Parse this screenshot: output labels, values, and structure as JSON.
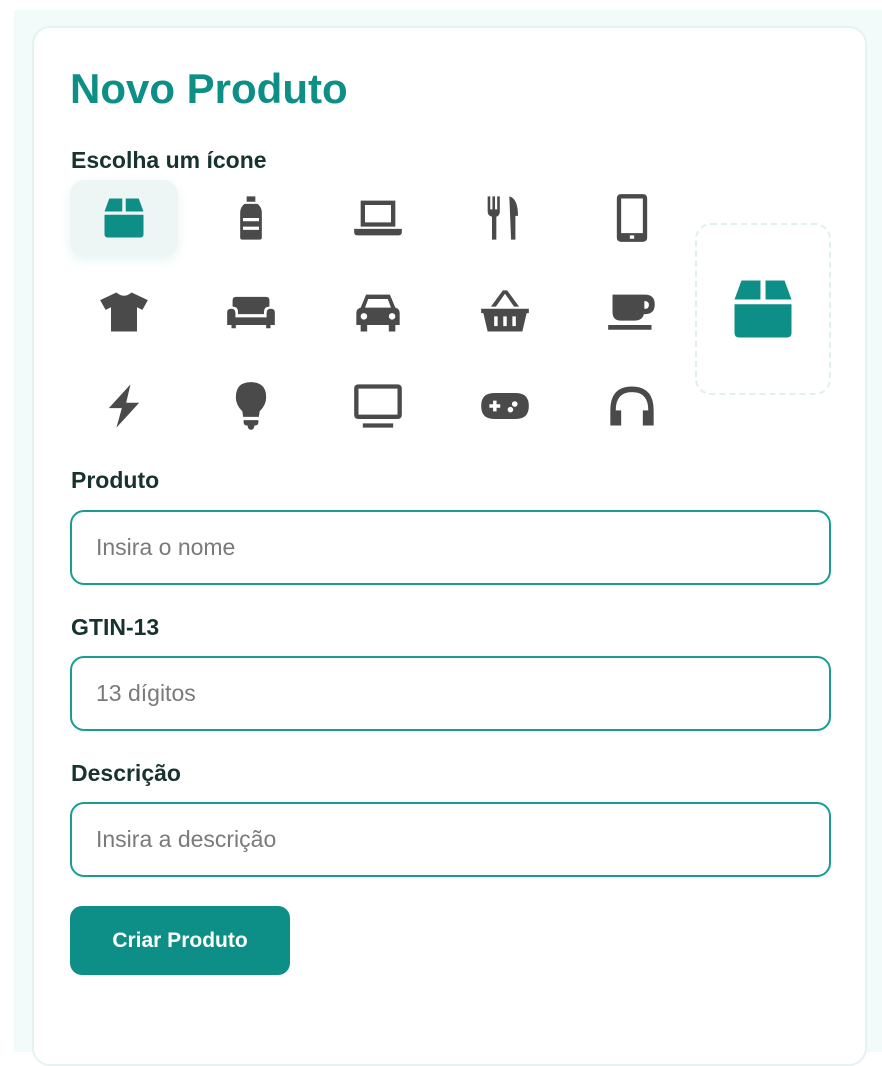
{
  "form": {
    "title": "Novo Produto",
    "icon_label": "Escolha um ícone",
    "icons": [
      {
        "name": "box-icon",
        "selected": true
      },
      {
        "name": "bottle-icon",
        "selected": false
      },
      {
        "name": "laptop-icon",
        "selected": false
      },
      {
        "name": "utensils-icon",
        "selected": false
      },
      {
        "name": "mobile-icon",
        "selected": false
      },
      {
        "name": "shirt-icon",
        "selected": false
      },
      {
        "name": "couch-icon",
        "selected": false
      },
      {
        "name": "car-icon",
        "selected": false
      },
      {
        "name": "basket-icon",
        "selected": false
      },
      {
        "name": "mug-icon",
        "selected": false
      },
      {
        "name": "bolt-icon",
        "selected": false
      },
      {
        "name": "lightbulb-icon",
        "selected": false
      },
      {
        "name": "monitor-icon",
        "selected": false
      },
      {
        "name": "gamepad-icon",
        "selected": false
      },
      {
        "name": "headphones-icon",
        "selected": false
      }
    ],
    "preview_icon": "box-icon",
    "product_label": "Produto",
    "product_placeholder": "Insira o nome",
    "product_value": "",
    "gtin_label": "GTIN-13",
    "gtin_placeholder": "13 dígitos",
    "gtin_value": "",
    "description_label": "Descrição",
    "description_placeholder": "Insira a descrição",
    "description_value": "",
    "submit_label": "Criar Produto"
  },
  "colors": {
    "accent": "#0d8f87",
    "icon_gray": "#4a4a4a",
    "label": "#17322f",
    "input_border": "#1b9c93"
  }
}
